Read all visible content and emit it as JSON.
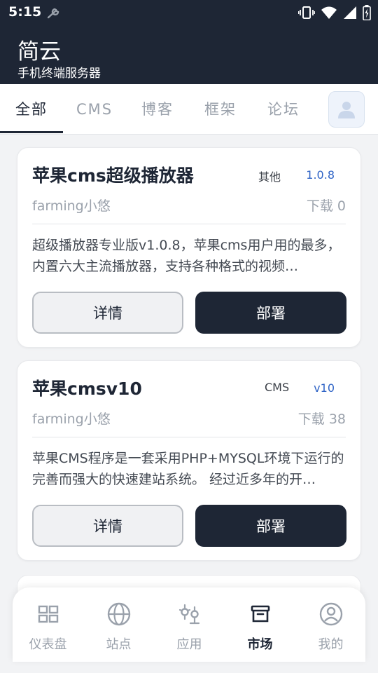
{
  "status_bar": {
    "time": "5:15"
  },
  "header": {
    "title": "简云",
    "subtitle": "手机终端服务器"
  },
  "tabs": [
    {
      "label": "全部",
      "active": true
    },
    {
      "label": "CMS",
      "active": false
    },
    {
      "label": "博客",
      "active": false
    },
    {
      "label": "框架",
      "active": false
    },
    {
      "label": "论坛",
      "active": false
    }
  ],
  "apps": [
    {
      "name": "苹果cms超级播放器",
      "category": "其他",
      "version": "1.0.8",
      "author": "farming小悠",
      "downloads": "下载 0",
      "description": "超级播放器专业版v1.0.8，苹果cms用户用的最多，内置六大主流播放器，支持各种格式的视频…",
      "detail_label": "详情",
      "deploy_label": "部署"
    },
    {
      "name": "苹果cmsv10",
      "category": "CMS",
      "version": "v10",
      "author": "farming小悠",
      "downloads": "下载 38",
      "description": "苹果CMS程序是一套采用PHP+MYSQL环境下运行的完善而强大的快速建站系统。 经过近多年的开…",
      "detail_label": "详情",
      "deploy_label": "部署"
    }
  ],
  "bottom_nav": [
    {
      "label": "仪表盘",
      "icon": "dashboard-icon",
      "active": false
    },
    {
      "label": "站点",
      "icon": "globe-icon",
      "active": false
    },
    {
      "label": "应用",
      "icon": "apps-icon",
      "active": false
    },
    {
      "label": "市场",
      "icon": "market-icon",
      "active": true
    },
    {
      "label": "我的",
      "icon": "user-icon",
      "active": false
    }
  ],
  "colors": {
    "primary": "#1e2635",
    "accent": "#2f64c6",
    "muted": "#9aa1ab"
  }
}
